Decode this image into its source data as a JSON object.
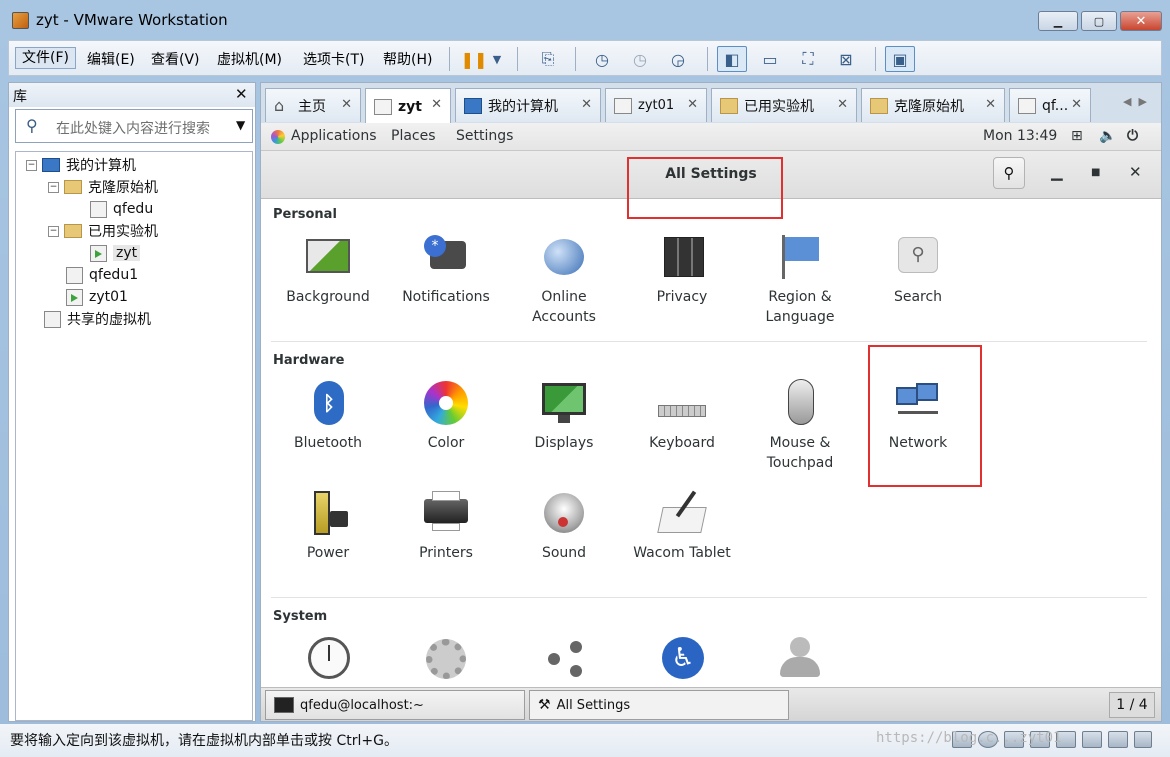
{
  "window": {
    "title": "zyt - VMware Workstation",
    "min": "▁",
    "max": "▢",
    "close": "✕"
  },
  "menu": [
    "文件(F)",
    "编辑(E)",
    "查看(V)",
    "虚拟机(M)",
    "选项卡(T)",
    "帮助(H)"
  ],
  "library": {
    "title": "库",
    "close": "✕",
    "search_placeholder": "在此处键入内容进行搜索",
    "tree": {
      "root": "我的计算机",
      "clone_folder": "克隆原始机",
      "qfedu": "qfedu",
      "used_folder": "已用实验机",
      "zyt": "zyt",
      "qfedu1": "qfedu1",
      "zyt01": "zyt01",
      "shared": "共享的虚拟机"
    }
  },
  "tabs": [
    "主页",
    "zyt",
    "我的计算机",
    "zyt01",
    "已用实验机",
    "克隆原始机",
    "qf..."
  ],
  "gnome": {
    "applications": "Applications",
    "places": "Places",
    "settings": "Settings",
    "clock": "Mon 13:49"
  },
  "all_settings": {
    "title": "All Settings",
    "personal_label": "Personal",
    "personal": [
      "Background",
      "Notifications",
      "Online Accounts",
      "Privacy",
      "Region & Language",
      "Search"
    ],
    "hardware_label": "Hardware",
    "hardware": [
      "Bluetooth",
      "Color",
      "Displays",
      "Keyboard",
      "Mouse & Touchpad",
      "Network",
      "Power",
      "Printers",
      "Sound",
      "Wacom Tablet"
    ],
    "system_label": "System"
  },
  "taskbar": {
    "terminal": "qfedu@localhost:~",
    "settings": "All Settings",
    "pager": "1 / 4"
  },
  "status": {
    "text": "要将输入定向到该虚拟机，请在虚拟机内部单击或按 Ctrl+G。",
    "watermark": "https://blog.c...zyt01"
  }
}
